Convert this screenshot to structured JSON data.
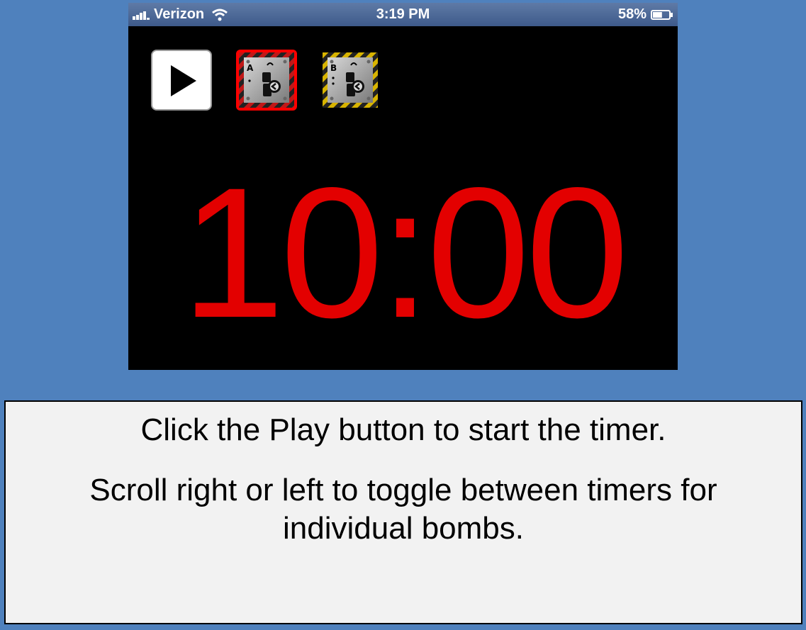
{
  "status_bar": {
    "carrier": "Verizon",
    "time": "3:19 PM",
    "battery": "58%",
    "battery_level": 0.58,
    "icons": [
      "signal-icon",
      "wifi-icon",
      "battery-icon"
    ]
  },
  "toolbar": {
    "play_icon": "play-icon",
    "bomb_tiles": [
      {
        "letter": "A",
        "icon": "bomb-icon",
        "selected": true,
        "accent": "#ff0000"
      },
      {
        "letter": "B",
        "icon": "bomb-icon",
        "selected": false,
        "accent": "#e0c000"
      }
    ]
  },
  "timer": {
    "display": "10:00",
    "color": "#e30000"
  },
  "instructions": {
    "line1": "Click the Play button to start the timer.",
    "line2": "Scroll right or left to toggle between timers for individual bombs."
  },
  "colors": {
    "background": "#4f81bd",
    "screen": "#000000",
    "panel": "#f2f2f2"
  }
}
